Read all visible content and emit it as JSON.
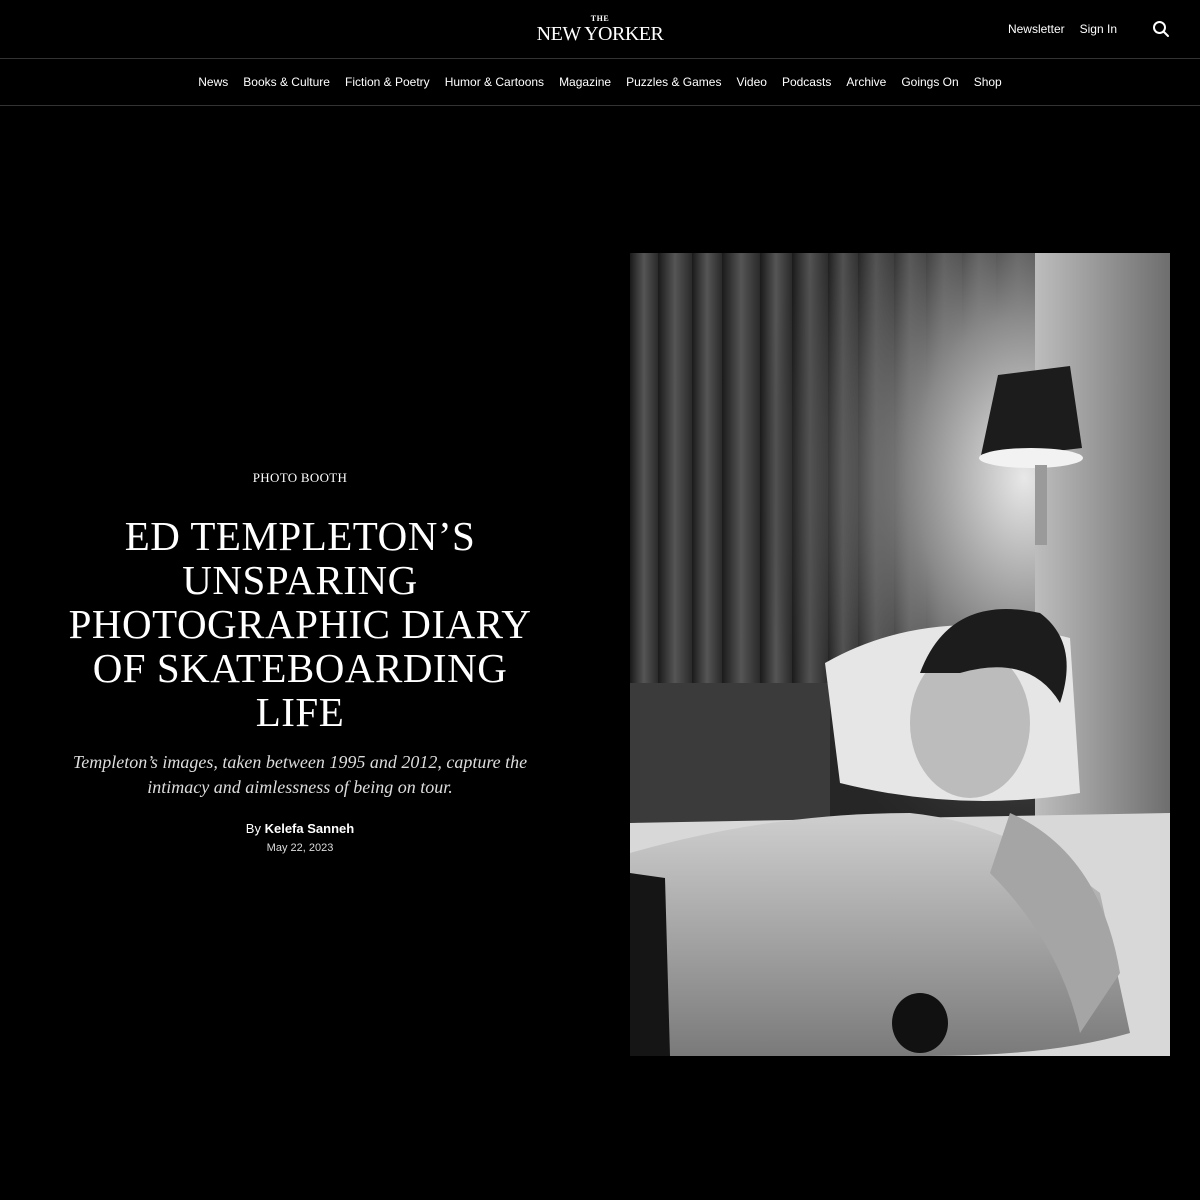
{
  "header": {
    "logo_the": "THE",
    "logo_main": "NEW YORKER",
    "newsletter_label": "Newsletter",
    "signin_label": "Sign In",
    "search_icon": "search-icon"
  },
  "nav": {
    "items": [
      "News",
      "Books & Culture",
      "Fiction & Poetry",
      "Humor & Cartoons",
      "Magazine",
      "Puzzles & Games",
      "Video",
      "Podcasts",
      "Archive",
      "Goings On",
      "Shop"
    ]
  },
  "article": {
    "rubric": "PHOTO BOOTH",
    "headline": "Ed Templeton’s Unsparing Photographic Diary of Skateboarding Life",
    "dek": "Templeton’s images, taken between 1995 and 2012, capture the intimacy and aimlessness of being on tour.",
    "byline_prefix": "By",
    "author": "Kelefa Sanneh",
    "date": "May 22, 2023"
  }
}
